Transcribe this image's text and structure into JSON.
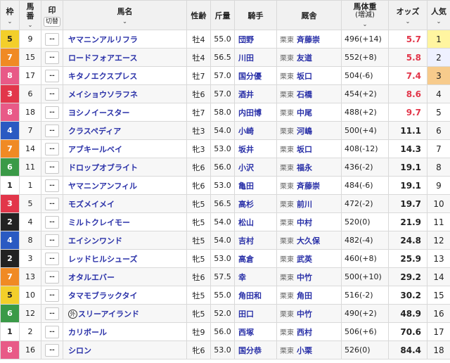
{
  "colors": {
    "waku": {
      "1": {
        "bg": "#ffffff",
        "fg": "#222222"
      },
      "2": {
        "bg": "#222222",
        "fg": "#ffffff"
      },
      "3": {
        "bg": "#e2364a",
        "fg": "#ffffff"
      },
      "4": {
        "bg": "#2a5ac2",
        "fg": "#ffffff"
      },
      "5": {
        "bg": "#f3cf2a",
        "fg": "#222222"
      },
      "6": {
        "bg": "#3a9a47",
        "fg": "#ffffff"
      },
      "7": {
        "bg": "#f08a24",
        "fg": "#ffffff"
      },
      "8": {
        "bg": "#e85a87",
        "fg": "#ffffff"
      }
    },
    "odds_red": "#e2364a",
    "odds_normal": "#222222",
    "pop_bg": {
      "1": "#fff5a0",
      "2": "#eef1ff",
      "3": "#f7cb8c"
    }
  },
  "header": {
    "waku": "枠",
    "umaban_top": "馬",
    "umaban_bottom": "番",
    "mark": "印",
    "mark_button": "切替",
    "horse": "馬名",
    "sexage": "性齢",
    "weight": "斤量",
    "jockey": "騎手",
    "stable": "厩舎",
    "bodyweight_top": "馬体重",
    "bodyweight_bottom": "(増減)",
    "odds": "オッズ",
    "popularity": "人気",
    "chevron": "⌄"
  },
  "rows": [
    {
      "waku": "5",
      "umaban": "9",
      "mark": "--",
      "horse": "ヤマニンアルリフラ",
      "sexage": "牡4",
      "weight": "55.0",
      "jockey": "団野",
      "region": "栗東",
      "trainer": "斉藤崇",
      "bodyweight": "496(+14)",
      "odds": "5.7",
      "odds_red": true,
      "pop": "1"
    },
    {
      "waku": "7",
      "umaban": "15",
      "mark": "--",
      "horse": "ロードフォアエース",
      "sexage": "牡4",
      "weight": "56.5",
      "jockey": "川田",
      "region": "栗東",
      "trainer": "友道",
      "bodyweight": "552(+8)",
      "odds": "5.8",
      "odds_red": true,
      "pop": "2"
    },
    {
      "waku": "8",
      "umaban": "17",
      "mark": "--",
      "horse": "キタノエクスプレス",
      "sexage": "牡7",
      "weight": "57.0",
      "jockey": "国分優",
      "region": "栗東",
      "trainer": "坂口",
      "bodyweight": "504(-6)",
      "odds": "7.4",
      "odds_red": true,
      "pop": "3"
    },
    {
      "waku": "3",
      "umaban": "6",
      "mark": "--",
      "horse": "メイショウソラフネ",
      "sexage": "牡6",
      "weight": "57.0",
      "jockey": "酒井",
      "region": "栗東",
      "trainer": "石橋",
      "bodyweight": "454(+2)",
      "odds": "8.6",
      "odds_red": true,
      "pop": "4"
    },
    {
      "waku": "8",
      "umaban": "18",
      "mark": "--",
      "horse": "ヨシノイースター",
      "sexage": "牡7",
      "weight": "58.0",
      "jockey": "内田博",
      "region": "栗東",
      "trainer": "中尾",
      "bodyweight": "488(+2)",
      "odds": "9.7",
      "odds_red": true,
      "pop": "5"
    },
    {
      "waku": "4",
      "umaban": "7",
      "mark": "--",
      "horse": "クラスペディア",
      "sexage": "牡3",
      "weight": "54.0",
      "jockey": "小崎",
      "region": "栗東",
      "trainer": "河嶋",
      "bodyweight": "500(+4)",
      "odds": "11.1",
      "odds_red": false,
      "pop": "6"
    },
    {
      "waku": "7",
      "umaban": "14",
      "mark": "--",
      "horse": "アブキールベイ",
      "sexage": "牝3",
      "weight": "53.0",
      "jockey": "坂井",
      "region": "栗東",
      "trainer": "坂口",
      "bodyweight": "408(-12)",
      "odds": "14.3",
      "odds_red": false,
      "pop": "7"
    },
    {
      "waku": "6",
      "umaban": "11",
      "mark": "--",
      "horse": "ドロップオブライト",
      "sexage": "牝6",
      "weight": "56.0",
      "jockey": "小沢",
      "region": "栗東",
      "trainer": "福永",
      "bodyweight": "436(-2)",
      "odds": "19.1",
      "odds_red": false,
      "pop": "8"
    },
    {
      "waku": "1",
      "umaban": "1",
      "mark": "--",
      "horse": "ヤマニンアンフィル",
      "sexage": "牝6",
      "weight": "53.0",
      "jockey": "亀田",
      "region": "栗東",
      "trainer": "斉藤崇",
      "bodyweight": "484(-6)",
      "odds": "19.1",
      "odds_red": false,
      "pop": "9"
    },
    {
      "waku": "3",
      "umaban": "5",
      "mark": "--",
      "horse": "モズメイメイ",
      "sexage": "牝5",
      "weight": "56.5",
      "jockey": "高杉",
      "region": "栗東",
      "trainer": "前川",
      "bodyweight": "472(-2)",
      "odds": "19.7",
      "odds_red": false,
      "pop": "10"
    },
    {
      "waku": "2",
      "umaban": "4",
      "mark": "--",
      "horse": "ミルトクレイモー",
      "sexage": "牝5",
      "weight": "54.0",
      "jockey": "松山",
      "region": "栗東",
      "trainer": "中村",
      "bodyweight": "520(0)",
      "odds": "21.9",
      "odds_red": false,
      "pop": "11"
    },
    {
      "waku": "4",
      "umaban": "8",
      "mark": "--",
      "horse": "エイシンワンド",
      "sexage": "牡5",
      "weight": "54.0",
      "jockey": "吉村",
      "region": "栗東",
      "trainer": "大久保",
      "bodyweight": "482(-4)",
      "odds": "24.8",
      "odds_red": false,
      "pop": "12"
    },
    {
      "waku": "2",
      "umaban": "3",
      "mark": "--",
      "horse": "レッドヒルシューズ",
      "sexage": "牝5",
      "weight": "53.0",
      "jockey": "高倉",
      "region": "栗東",
      "trainer": "武英",
      "bodyweight": "460(+8)",
      "odds": "25.9",
      "odds_red": false,
      "pop": "13"
    },
    {
      "waku": "7",
      "umaban": "13",
      "mark": "--",
      "horse": "オタルエバー",
      "sexage": "牡6",
      "weight": "57.5",
      "jockey": "幸",
      "region": "栗東",
      "trainer": "中竹",
      "bodyweight": "500(+10)",
      "odds": "29.2",
      "odds_red": false,
      "pop": "14"
    },
    {
      "waku": "5",
      "umaban": "10",
      "mark": "--",
      "horse": "タマモブラックタイ",
      "sexage": "牡5",
      "weight": "55.0",
      "jockey": "角田和",
      "region": "栗東",
      "trainer": "角田",
      "bodyweight": "516(-2)",
      "odds": "30.2",
      "odds_red": false,
      "pop": "15"
    },
    {
      "waku": "6",
      "umaban": "12",
      "mark": "--",
      "horse": "スリーアイランド",
      "maru": "外",
      "sexage": "牝5",
      "weight": "52.0",
      "jockey": "田口",
      "region": "栗東",
      "trainer": "中竹",
      "bodyweight": "490(+2)",
      "odds": "48.9",
      "odds_red": false,
      "pop": "16"
    },
    {
      "waku": "1",
      "umaban": "2",
      "mark": "--",
      "horse": "カリボール",
      "sexage": "牡9",
      "weight": "56.0",
      "jockey": "西塚",
      "region": "栗東",
      "trainer": "西村",
      "bodyweight": "506(+6)",
      "odds": "70.6",
      "odds_red": false,
      "pop": "17"
    },
    {
      "waku": "8",
      "umaban": "16",
      "mark": "--",
      "horse": "シロン",
      "sexage": "牝6",
      "weight": "53.0",
      "jockey": "国分恭",
      "region": "栗東",
      "trainer": "小栗",
      "bodyweight": "526(0)",
      "odds": "84.4",
      "odds_red": false,
      "pop": "18"
    }
  ]
}
